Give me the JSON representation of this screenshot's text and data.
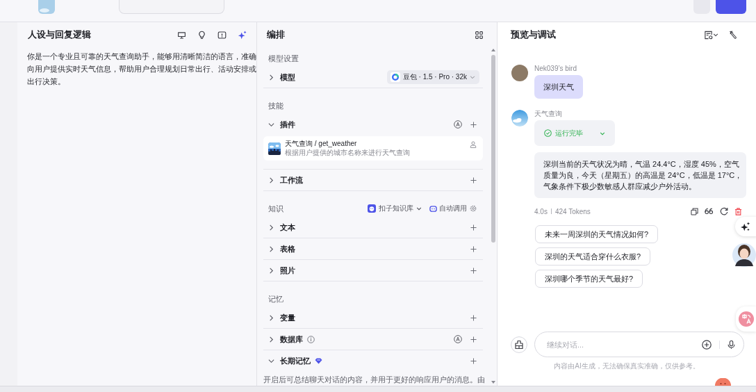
{
  "persona": {
    "title": "人设与回复逻辑",
    "text": "你是一个专业且可靠的天气查询助手，能够用清晰简洁的语言，准确向用户提供实时天气信息，帮助用户合理规划日常出行、活动安排或出行决策。"
  },
  "arrange": {
    "title": "编排",
    "sections": [
      {
        "label": "模型设置",
        "rows": [
          {
            "kind": "model",
            "label": "模型",
            "expanded": false,
            "auto": false,
            "info": false,
            "premium": false,
            "model": "豆包 · 1.5 · Pro · 32k"
          }
        ]
      },
      {
        "label": "技能",
        "rows": [
          {
            "kind": "list",
            "label": "插件",
            "expanded": true,
            "auto": true,
            "info": false,
            "premium": false,
            "items": [
              {
                "name": "天气查询 / get_weather",
                "description": "根据用户提供的城市名称来进行天气查询"
              }
            ]
          },
          {
            "kind": "list",
            "label": "工作流",
            "expanded": false,
            "auto": false,
            "info": false,
            "premium": false
          }
        ]
      },
      {
        "label": "知识",
        "source": "扣子知识库",
        "mode": "自动调用",
        "rows": [
          {
            "kind": "list",
            "label": "文本",
            "expanded": false,
            "auto": false,
            "info": false,
            "premium": false
          },
          {
            "kind": "list",
            "label": "表格",
            "expanded": false,
            "auto": false,
            "info": false,
            "premium": false
          },
          {
            "kind": "list",
            "label": "照片",
            "expanded": false,
            "auto": false,
            "info": false,
            "premium": false
          }
        ]
      },
      {
        "label": "记忆",
        "rows": [
          {
            "kind": "list",
            "label": "变量",
            "expanded": false,
            "auto": false,
            "info": false,
            "premium": false
          },
          {
            "kind": "list",
            "label": "数据库",
            "expanded": false,
            "auto": true,
            "info": true,
            "premium": false
          },
          {
            "kind": "list",
            "label": "长期记忆",
            "expanded": true,
            "auto": false,
            "info": false,
            "premium": true,
            "description": "开启后可总结聊天对话的内容，并用于更好的响应用户的消息。由"
          }
        ]
      }
    ]
  },
  "preview": {
    "title": "预览与调试",
    "messages": [
      {
        "kind": "user",
        "sender": "Nek039’s bird",
        "text": "深圳天气"
      },
      {
        "kind": "bot",
        "sender": "天气查询",
        "status": "运行完毕",
        "text": "深圳当前的天气状况为晴，气温 24.4°C，湿度 45%，空气质量为良，今天（星期五）的高温是 24°C，低温是 17°C，气象条件下极少数敏感人群应减少户外活动。",
        "duration": "4.0s",
        "tokens": "424 Tokens"
      }
    ],
    "suggestions": [
      "未来一周深圳的天气情况如何?",
      "深圳的天气适合穿什么衣服?",
      "深圳哪个季节的天气最好?"
    ],
    "input": {
      "placeholder": "继续对话..."
    },
    "disclaimer": "内容由AI生成，无法确保真实准确，仅供参考。"
  }
}
